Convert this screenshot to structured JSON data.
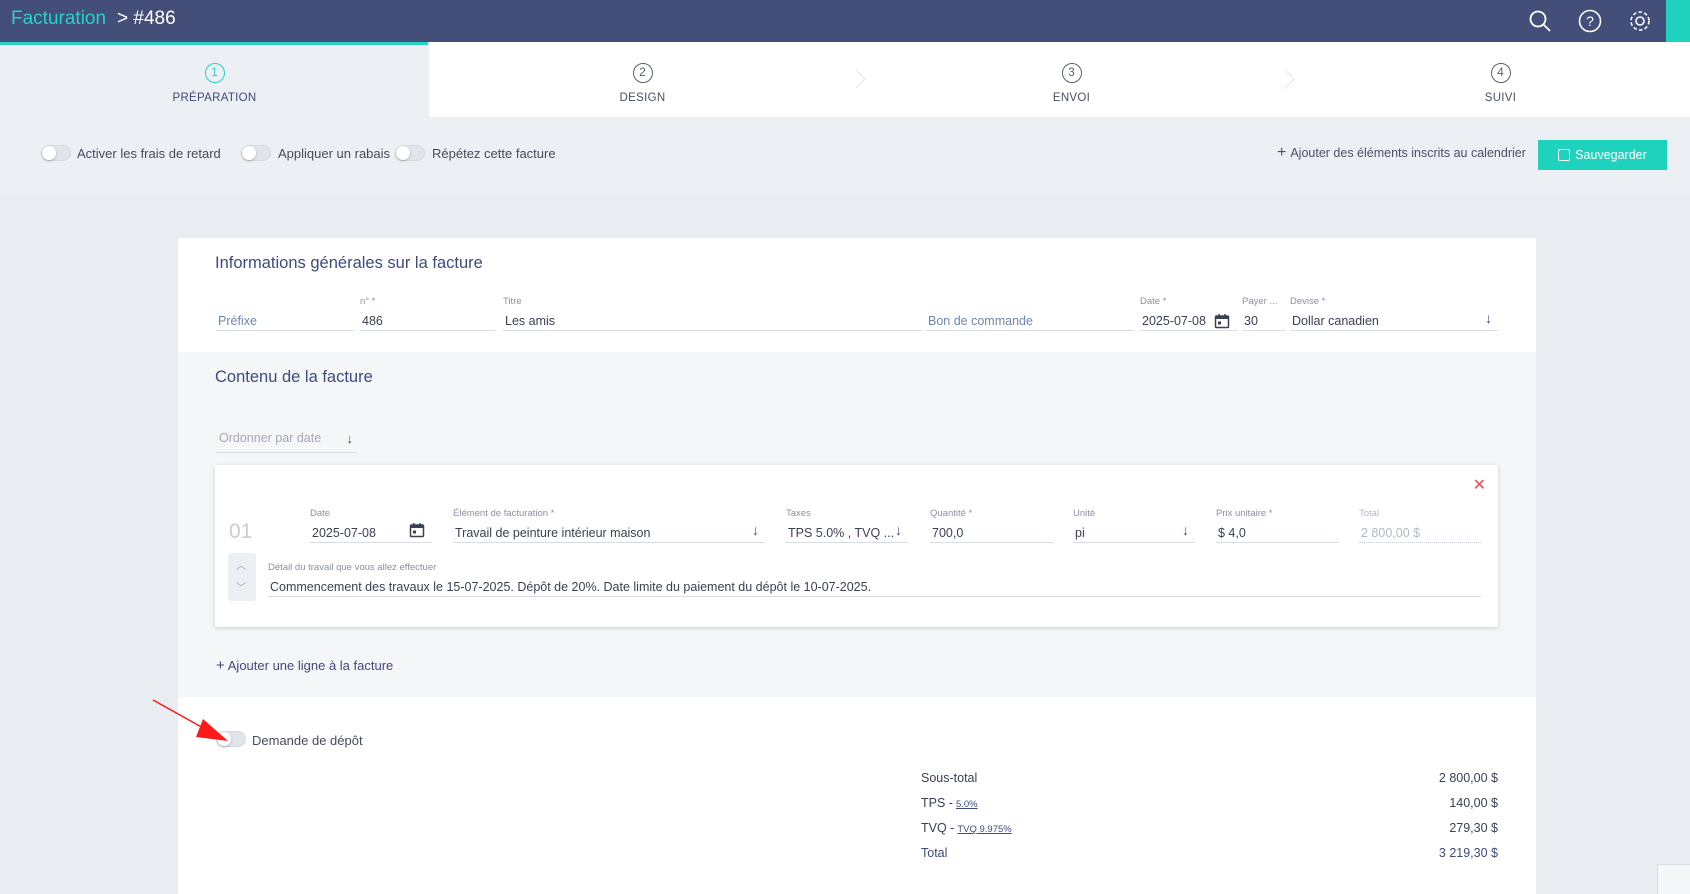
{
  "header": {
    "title": "Facturation",
    "breadcrumb": "> #486"
  },
  "steps": [
    {
      "num": "1",
      "label": "PRÉPARATION"
    },
    {
      "num": "2",
      "label": "DESIGN"
    },
    {
      "num": "3",
      "label": "ENVOI"
    },
    {
      "num": "4",
      "label": "SUIVI"
    }
  ],
  "options": {
    "late_fees": "Activer les frais de retard",
    "discount": "Appliquer un rabais",
    "repeat": "Répétez cette facture",
    "add_calendar": "Ajouter des éléments inscrits au calendrier",
    "save": "Sauvegarder"
  },
  "general": {
    "title": "Informations générales sur la facture",
    "prefix_placeholder": "Préfixe",
    "number_label": "n° *",
    "number": "486",
    "title_label": "Titre",
    "title_value": "Les amis",
    "po_placeholder": "Bon de commande",
    "date_label": "Date *",
    "date": "2025-07-08",
    "pay_label": "Payer ...",
    "pay": "30",
    "currency_label": "Devise *",
    "currency": "Dollar canadien"
  },
  "content": {
    "title": "Contenu de la facture",
    "sort": "Ordonner par date",
    "add_line": "Ajouter une ligne à la facture"
  },
  "line": {
    "num": "01",
    "date_label": "Date",
    "date": "2025-07-08",
    "item_label": "Élément de facturation *",
    "item": "Travail de peinture intérieur maison",
    "taxes_label": "Taxes",
    "taxes": "TPS 5.0% , TVQ ...",
    "qty_label": "Quantité *",
    "qty": "700,0",
    "unit_label": "Unité",
    "unit": "pi",
    "price_label": "Prix unitaire *",
    "price": "$ 4,0",
    "total_label": "Total",
    "total": "2 800,00 $",
    "detail_label": "Détail du travail que vous allez effectuer",
    "detail": "Commencement des travaux le 15-07-2025. Dépôt de 20%. Date limite du paiement du dépôt le 10-07-2025."
  },
  "deposit": {
    "label": "Demande de dépôt"
  },
  "totals": {
    "subtotal_label": "Sous-total",
    "subtotal": "2 800,00 $",
    "tps_label": "TPS -",
    "tps_link": "5.0%",
    "tps": "140,00 $",
    "tvq_label": "TVQ -",
    "tvq_link": "TVQ 9.975%",
    "tvq": "279,30 $",
    "total_label": "Total",
    "total": "3 219,30 $"
  },
  "colors": {
    "header_bg": "#434f78",
    "accent": "#1fd2bd",
    "link": "#3e4a80",
    "danger": "#e2504f"
  }
}
